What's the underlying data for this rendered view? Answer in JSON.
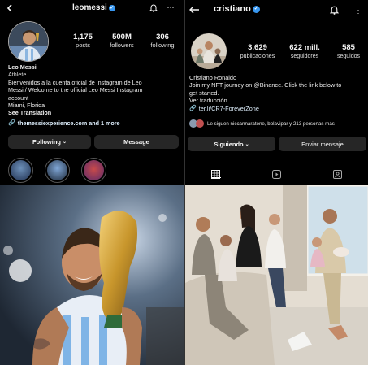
{
  "messi": {
    "username": "leomessi",
    "stats": [
      {
        "value": "1,175",
        "label": "posts"
      },
      {
        "value": "500M",
        "label": "followers"
      },
      {
        "value": "306",
        "label": "following"
      }
    ],
    "name": "Leo Messi",
    "category": "Athlete",
    "bio_lines": [
      "Bienvenidos a la cuenta oficial de Instagram de Leo",
      "Messi / Welcome to the official Leo Messi Instagram",
      "account",
      "Miami, Florida"
    ],
    "see_translation": "See Translation",
    "link": "themessiexperience.com and 1 more",
    "following_button": "Following",
    "message_button": "Message"
  },
  "cristiano": {
    "username": "cristiano",
    "stats": [
      {
        "value": "3.629",
        "label": "publicaciones"
      },
      {
        "value": "622 mill.",
        "label": "seguidores"
      },
      {
        "value": "585",
        "label": "seguidos"
      }
    ],
    "name": "Cristiano Ronaldo",
    "bio_lines": [
      "Join my NFT journey on @Binance. Click the link below to",
      "get started."
    ],
    "see_translation": "Ver traducción",
    "link": "ter.li/CR7-ForeverZone",
    "followed_by": "Le siguen niccannaratone, bolavipar y 213 personas más",
    "following_button": "Siguiendo",
    "message_button": "Enviar mensaje"
  },
  "colors": {
    "background": "#000000",
    "button": "#262626",
    "verified": "#3897f0",
    "link": "#e0f1ff"
  },
  "icons": [
    "back-arrow-icon",
    "verified-icon",
    "bell-icon",
    "more-icon",
    "link-icon",
    "chevron-down-icon",
    "grid-icon",
    "reels-icon",
    "tagged-icon"
  ]
}
